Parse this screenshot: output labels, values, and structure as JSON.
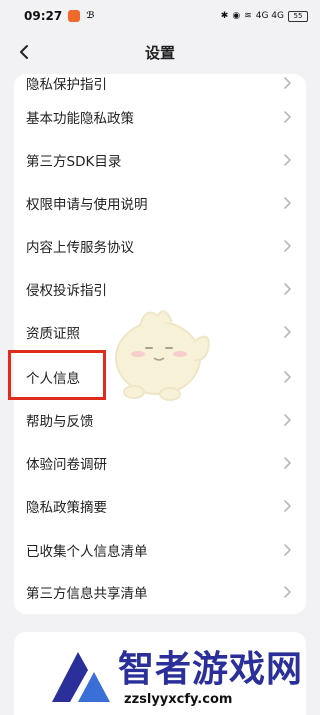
{
  "status_bar": {
    "time": "09:27",
    "right_text": "4G  4G",
    "battery": "55"
  },
  "nav": {
    "title": "设置",
    "back_icon": "chevron-left-icon"
  },
  "list": {
    "items": [
      {
        "label": "隐私保护指引",
        "icon": "chevron-right-icon"
      },
      {
        "label": "基本功能隐私政策",
        "icon": "chevron-right-icon"
      },
      {
        "label": "第三方SDK目录",
        "icon": "chevron-right-icon"
      },
      {
        "label": "权限申请与使用说明",
        "icon": "chevron-right-icon"
      },
      {
        "label": "内容上传服务协议",
        "icon": "chevron-right-icon"
      },
      {
        "label": "侵权投诉指引",
        "icon": "chevron-right-icon"
      },
      {
        "label": "资质证照",
        "icon": "chevron-right-icon"
      },
      {
        "label": "个人信息",
        "icon": "chevron-right-icon"
      },
      {
        "label": "帮助与反馈",
        "icon": "chevron-right-icon"
      },
      {
        "label": "体验问卷调研",
        "icon": "chevron-right-icon"
      },
      {
        "label": "隐私政策摘要",
        "icon": "chevron-right-icon"
      },
      {
        "label": "已收集个人信息清单",
        "icon": "chevron-right-icon"
      },
      {
        "label": "第三方信息共享清单",
        "icon": "chevron-right-icon"
      }
    ]
  },
  "highlight_color": "#e02a1c",
  "watermark": {
    "text": "智者游戏网",
    "url": "zzslyyxcfy.com"
  }
}
